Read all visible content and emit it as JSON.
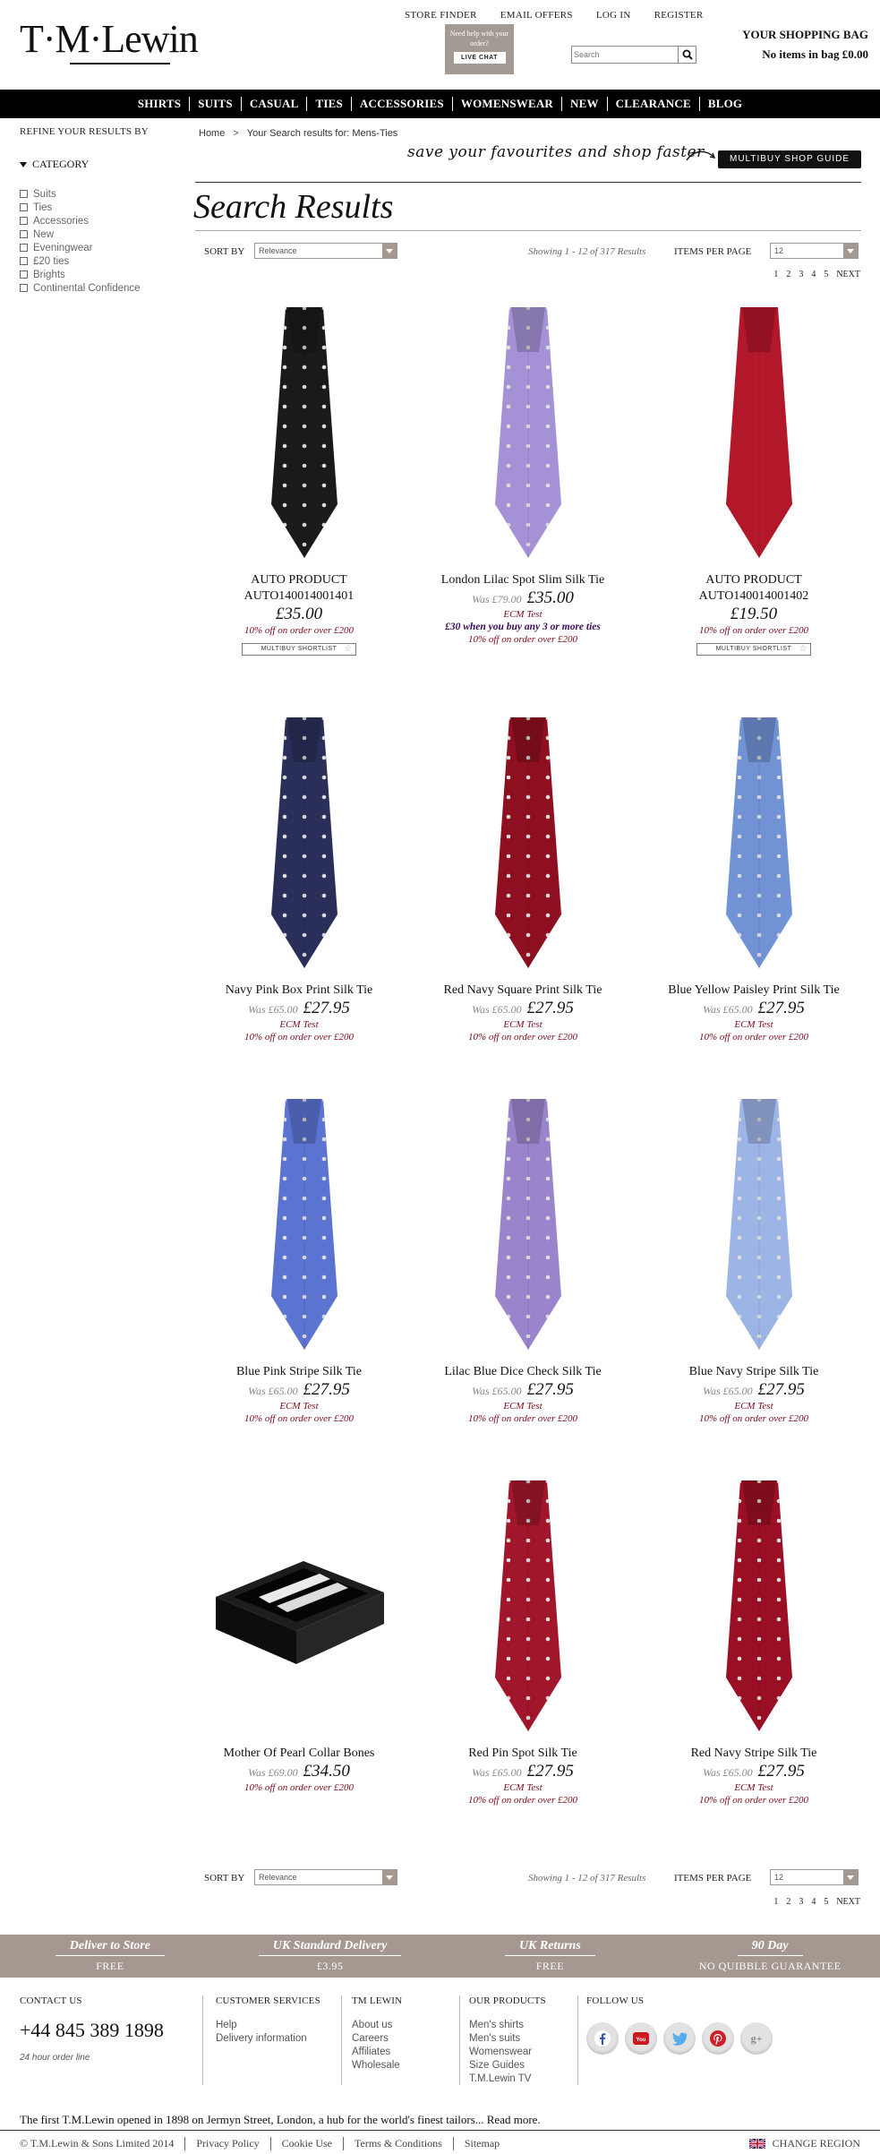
{
  "header": {
    "logo": "T·M·Lewin",
    "top_links": [
      "STORE FINDER",
      "EMAIL OFFERS",
      "LOG IN",
      "REGISTER"
    ],
    "live_chat": {
      "question": "Need help with your order?",
      "button": "LIVE CHAT"
    },
    "search_placeholder": "Search",
    "bag_title": "YOUR SHOPPING BAG",
    "bag_status": "No items in bag £0.00"
  },
  "nav": [
    "SHIRTS",
    "SUITS",
    "CASUAL",
    "TIES",
    "ACCESSORIES",
    "WOMENSWEAR",
    "NEW",
    "CLEARANCE",
    "BLOG"
  ],
  "sidebar": {
    "refine": "REFINE YOUR RESULTS BY",
    "category_title": "CATEGORY",
    "categories": [
      "Suits",
      "Ties",
      "Accessories",
      "New",
      "Eveningwear",
      "£20 ties",
      "Brights",
      "Continental Confidence"
    ]
  },
  "breadcrumb": {
    "home": "Home",
    "sep": ">",
    "current": "Your Search results for: Mens-Ties"
  },
  "promo_banner": {
    "text": "save your favourites and shop faster",
    "button": "MULTIBUY SHOP GUIDE"
  },
  "page_title": "Search Results",
  "sort": {
    "label": "SORT BY",
    "value": "Relevance",
    "showing": "Showing 1 - 12 of 317 Results",
    "ipp_label": "ITEMS PER PAGE",
    "ipp_value": "12",
    "pages": [
      "1",
      "2",
      "3",
      "4",
      "5",
      "NEXT"
    ]
  },
  "products": [
    {
      "name": "AUTO PRODUCT AUTO140014001401",
      "was": "",
      "price": "£35.00",
      "ecm": "",
      "promo": "",
      "offer": "10% off on order over £200",
      "shortlist": "MULTIBUY SHORTLIST",
      "image": "black-spot-tie"
    },
    {
      "name": "London Lilac Spot Slim Silk Tie",
      "was": "Was £79.00",
      "price": "£35.00",
      "ecm": "ECM Test",
      "promo": "£30 when you buy any 3 or more ties",
      "offer": "10% off on order over £200",
      "shortlist": "",
      "image": "lilac-spot-tie"
    },
    {
      "name": "AUTO PRODUCT AUTO140014001402",
      "was": "",
      "price": "£19.50",
      "ecm": "",
      "promo": "",
      "offer": "10% off on order over £200",
      "shortlist": "MULTIBUY SHORTLIST",
      "image": "red-plain-tie"
    },
    {
      "name": "Navy Pink Box Print Silk Tie",
      "was": "Was £65.00",
      "price": "£27.95",
      "ecm": "ECM Test",
      "promo": "",
      "offer": "10% off on order over £200",
      "shortlist": "",
      "image": "navy-box-tie"
    },
    {
      "name": "Red Navy Square Print Silk Tie",
      "was": "Was £65.00",
      "price": "£27.95",
      "ecm": "ECM Test",
      "promo": "",
      "offer": "10% off on order over £200",
      "shortlist": "",
      "image": "red-square-tie"
    },
    {
      "name": "Blue Yellow Paisley Print Silk Tie",
      "was": "Was £65.00",
      "price": "£27.95",
      "ecm": "ECM Test",
      "promo": "",
      "offer": "10% off on order over £200",
      "shortlist": "",
      "image": "blue-paisley-tie"
    },
    {
      "name": "Blue Pink Stripe Silk Tie",
      "was": "Was £65.00",
      "price": "£27.95",
      "ecm": "ECM Test",
      "promo": "",
      "offer": "10% off on order over £200",
      "shortlist": "",
      "image": "blue-pink-stripe-tie"
    },
    {
      "name": "Lilac Blue Dice Check Silk Tie",
      "was": "Was £65.00",
      "price": "£27.95",
      "ecm": "ECM Test",
      "promo": "",
      "offer": "10% off on order over £200",
      "shortlist": "",
      "image": "lilac-check-tie"
    },
    {
      "name": "Blue Navy Stripe Silk Tie",
      "was": "Was £65.00",
      "price": "£27.95",
      "ecm": "ECM Test",
      "promo": "",
      "offer": "10% off on order over £200",
      "shortlist": "",
      "image": "blue-navy-stripe-tie"
    },
    {
      "name": "Mother Of Pearl Collar Bones",
      "was": "Was £69.00",
      "price": "£34.50",
      "ecm": "",
      "promo": "",
      "offer": "10% off on order over £200",
      "shortlist": "",
      "image": "collar-bones-box"
    },
    {
      "name": "Red Pin Spot Silk Tie",
      "was": "Was £65.00",
      "price": "£27.95",
      "ecm": "ECM Test",
      "promo": "",
      "offer": "10% off on order over £200",
      "shortlist": "",
      "image": "red-pin-spot-tie"
    },
    {
      "name": "Red Navy Stripe Silk Tie",
      "was": "Was £65.00",
      "price": "£27.95",
      "ecm": "ECM Test",
      "promo": "",
      "offer": "10% off on order over £200",
      "shortlist": "",
      "image": "red-navy-stripe-tie"
    }
  ],
  "delivery": [
    {
      "title": "Deliver to Store",
      "sub": "FREE"
    },
    {
      "title": "UK Standard Delivery",
      "sub": "£3.95"
    },
    {
      "title": "UK Returns",
      "sub": "FREE"
    },
    {
      "title": "90 Day",
      "sub": "NO QUIBBLE GUARANTEE"
    }
  ],
  "footer": {
    "contact_title": "CONTACT US",
    "phone": "+44 845 389 1898",
    "order_line": "24 hour order line",
    "customer_title": "CUSTOMER SERVICES",
    "customer_links": [
      "Help",
      "Delivery information"
    ],
    "tmlewin_title": "TM LEWIN",
    "tmlewin_links": [
      "About us",
      "Careers",
      "Affiliates",
      "Wholesale"
    ],
    "products_title": "OUR PRODUCTS",
    "products_links": [
      "Men's shirts",
      "Men's suits",
      "Womenswear",
      "Size Guides",
      "T.M.Lewin TV"
    ],
    "follow_title": "FOLLOW US",
    "social": [
      "facebook-icon",
      "youtube-icon",
      "twitter-icon",
      "pinterest-icon",
      "googleplus-icon"
    ],
    "blurb": "The first T.M.Lewin opened in 1898 on Jermyn Street, London, a hub for the world's finest tailors... Read more.",
    "copyright": "© T.M.Lewin & Sons Limited 2014",
    "bottom_links": [
      "Privacy Policy",
      "Cookie Use",
      "Terms & Conditions",
      "Sitemap"
    ],
    "change_region": "CHANGE REGION"
  },
  "colors": {
    "accent": "#a49890",
    "nav_bg": "#000000",
    "offer": "#7a0a1a",
    "promo": "#3a0a5a"
  }
}
